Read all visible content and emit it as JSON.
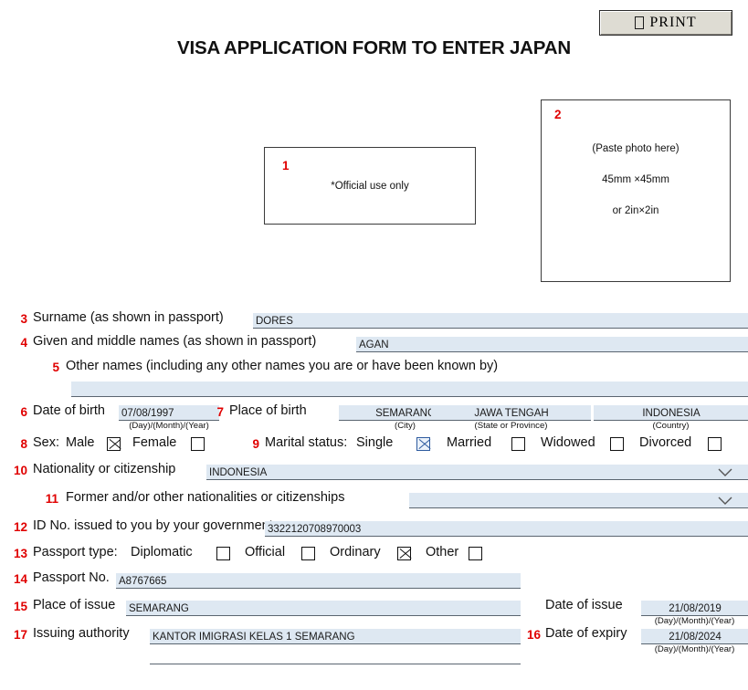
{
  "toolbar": {
    "print_label": "PRINT",
    "print_icon": "printer-icon"
  },
  "title": "VISA APPLICATION FORM TO ENTER JAPAN",
  "official_box": {
    "number": "1",
    "text": "*Official use only"
  },
  "photo_box": {
    "number": "2",
    "line1": "(Paste photo here)",
    "line2": "45mm ×45mm",
    "line3": "or 2in×2in"
  },
  "date_caption": "(Day)/(Month)/(Year)",
  "fields": {
    "surname": {
      "number": "3",
      "label": "Surname (as shown in passport)",
      "value": "DORES"
    },
    "given_names": {
      "number": "4",
      "label": "Given and middle names (as shown in passport)",
      "value": "AGAN"
    },
    "other_names": {
      "number": "5",
      "label": "Other names (including any other names you are or have been known by)",
      "value": ""
    },
    "date_of_birth": {
      "number": "6",
      "label": "Date of birth",
      "value": "07/08/1997",
      "caption": "(Day)/(Month)/(Year)"
    },
    "place_of_birth": {
      "number": "7",
      "label": "Place of birth",
      "city": {
        "value": "SEMARANG",
        "caption": "(City)"
      },
      "state": {
        "value": "JAWA TENGAH",
        "caption": "(State or Province)"
      },
      "country": {
        "value": "INDONESIA",
        "caption": "(Country)"
      }
    },
    "sex": {
      "number": "8",
      "label": "Sex:",
      "options": [
        {
          "label": "Male",
          "checked": true
        },
        {
          "label": "Female",
          "checked": false
        }
      ]
    },
    "marital_status": {
      "number": "9",
      "label": "Marital status:",
      "options": [
        {
          "label": "Single",
          "checked": true,
          "accent": true
        },
        {
          "label": "Married",
          "checked": false
        },
        {
          "label": "Widowed",
          "checked": false
        },
        {
          "label": "Divorced",
          "checked": false
        }
      ]
    },
    "nationality": {
      "number": "10",
      "label": "Nationality or citizenship",
      "value": "INDONESIA",
      "icon": "chevron-down-icon"
    },
    "former_nationalities": {
      "number": "11",
      "label": "Former and/or other nationalities or citizenships",
      "value": "",
      "icon": "chevron-down-icon"
    },
    "id_number": {
      "number": "12",
      "label": "ID No. issued to you by your government",
      "value": "3322120708970003"
    },
    "passport_type": {
      "number": "13",
      "label": "Passport type:",
      "options": [
        {
          "label": "Diplomatic",
          "checked": false
        },
        {
          "label": "Official",
          "checked": false
        },
        {
          "label": "Ordinary",
          "checked": true
        },
        {
          "label": "Other",
          "checked": false
        }
      ]
    },
    "passport_number": {
      "number": "14",
      "label": "Passport No.",
      "value": "A8767665"
    },
    "place_of_issue": {
      "number": "15",
      "label": "Place of issue",
      "value": "SEMARANG"
    },
    "date_of_issue": {
      "number": "16",
      "label": "Date of issue",
      "value": "21/08/2019",
      "caption": "(Day)/(Month)/(Year)"
    },
    "date_of_expiry": {
      "label": "Date of expiry",
      "value": "21/08/2024",
      "caption": "(Day)/(Month)/(Year)"
    },
    "issuing_authority": {
      "number": "17",
      "label": "Issuing authority",
      "value": "KANTOR IMIGRASI KELAS 1 SEMARANG"
    }
  },
  "colors": {
    "field_bg": "#dee8f2",
    "number_red": "#e00000",
    "accent_blue": "#2d5a9e"
  }
}
